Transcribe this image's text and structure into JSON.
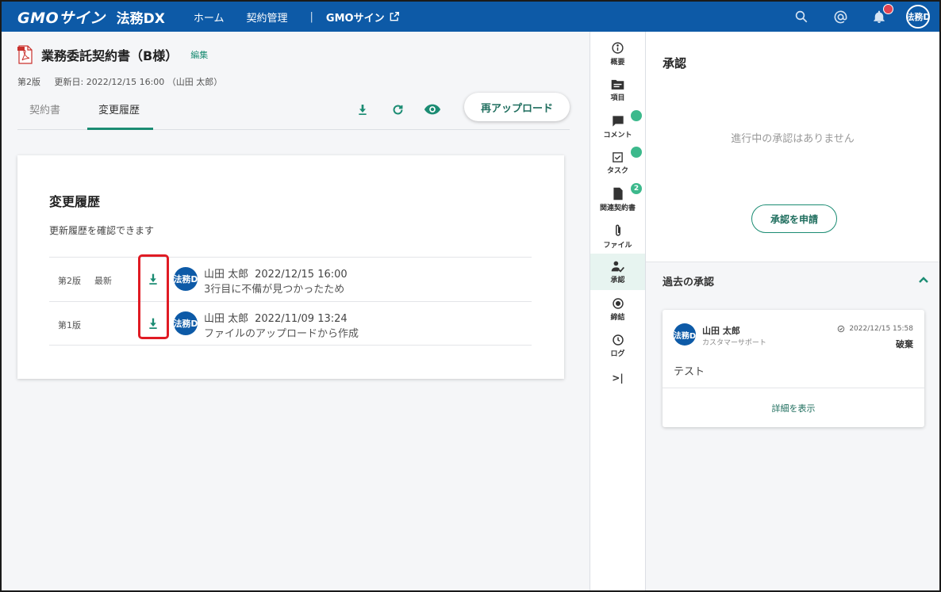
{
  "header": {
    "logo_text": "GMOサイン",
    "product_name": "法務DX",
    "nav": [
      "ホーム",
      "契約管理"
    ],
    "separator": "|",
    "external_link": "GMOサイン",
    "avatar_text": "法務D",
    "icons": [
      "search-icon",
      "mention-icon",
      "bell-icon"
    ],
    "notification_color": "#e04352",
    "brand_color": "#0d5aa7"
  },
  "document": {
    "title": "業務委託契約書（B様）",
    "edit_label": "編集",
    "version": "第2版",
    "updated": "更新日: 2022/12/15 16:00 （山田 太郎）",
    "tabs": [
      "契約書",
      "変更履歴"
    ],
    "active_tab": "変更履歴",
    "reupload_label": "再アップロード"
  },
  "history": {
    "title": "変更履歴",
    "description": "更新履歴を確認できます",
    "rows": [
      {
        "version": "第2版",
        "latest": "最新",
        "avatar": "法務D",
        "user": "山田 太郎",
        "datetime": "2022/12/15 16:00",
        "note": "3行目に不備が見つかったため"
      },
      {
        "version": "第1版",
        "latest": "",
        "avatar": "法務D",
        "user": "山田 太郎",
        "datetime": "2022/11/09 13:24",
        "note": "ファイルのアップロードから作成"
      }
    ]
  },
  "rail": {
    "items": [
      {
        "label": "概要",
        "icon": "info-icon"
      },
      {
        "label": "項目",
        "icon": "folder-icon"
      },
      {
        "label": "コメント",
        "icon": "comment-icon",
        "badge": ""
      },
      {
        "label": "タスク",
        "icon": "task-icon",
        "badge": ""
      },
      {
        "label": "関連契約書",
        "icon": "document-icon",
        "badge": "2"
      },
      {
        "label": "ファイル",
        "icon": "paperclip-icon"
      },
      {
        "label": "承認",
        "icon": "approval-icon"
      },
      {
        "label": "締結",
        "icon": "target-icon"
      },
      {
        "label": "ログ",
        "icon": "clock-icon"
      }
    ],
    "active": "承認",
    "collapse_label": ">|",
    "badge_color": "#3cb98c"
  },
  "approval_panel": {
    "title": "承認",
    "empty_text": "進行中の承認はありません",
    "request_button": "承認を申請",
    "past_title": "過去の承認",
    "past": {
      "avatar": "法務D",
      "name": "山田 太郎",
      "role": "カスタマーサポート",
      "time": "2022/12/15 15:58",
      "status": "破棄",
      "comment": "テスト",
      "detail_link": "詳細を表示"
    }
  },
  "colors": {
    "accent": "#1b8c73",
    "highlight_box": "#e01b24"
  }
}
